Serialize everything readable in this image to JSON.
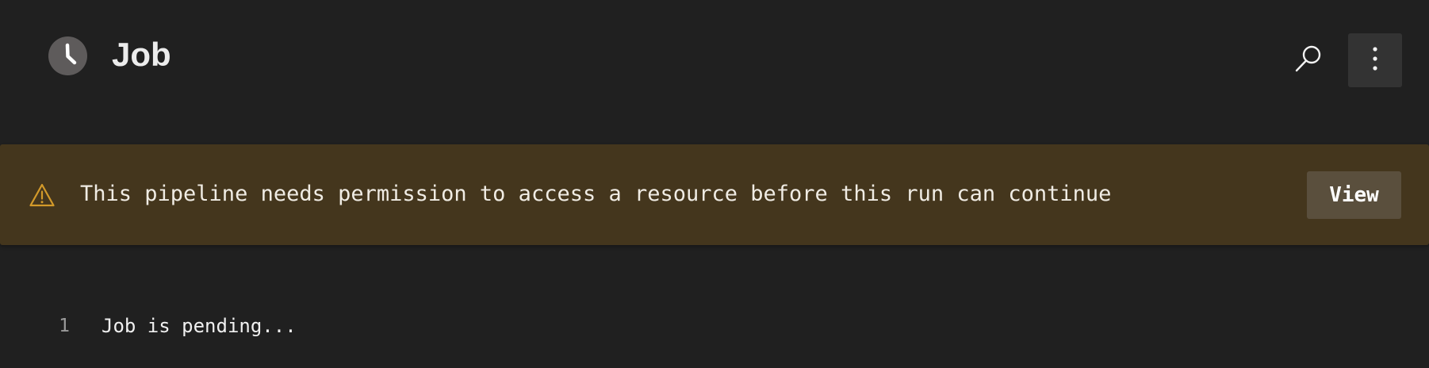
{
  "header": {
    "status_icon": "clock-icon",
    "title": "Job",
    "search_icon": "search-icon",
    "more_icon": "more-vertical-icon"
  },
  "banner": {
    "icon": "warning-icon",
    "message": "This pipeline needs permission to access a resource before this run can continue",
    "action_label": "View"
  },
  "log": {
    "lines": [
      {
        "number": "1",
        "text": "Job is pending..."
      }
    ]
  },
  "colors": {
    "background": "#202020",
    "banner_background": "#44361d",
    "warning_accent": "#d39a2a",
    "view_button": "#5a4f3d",
    "status_icon": "#5e5b5b"
  }
}
